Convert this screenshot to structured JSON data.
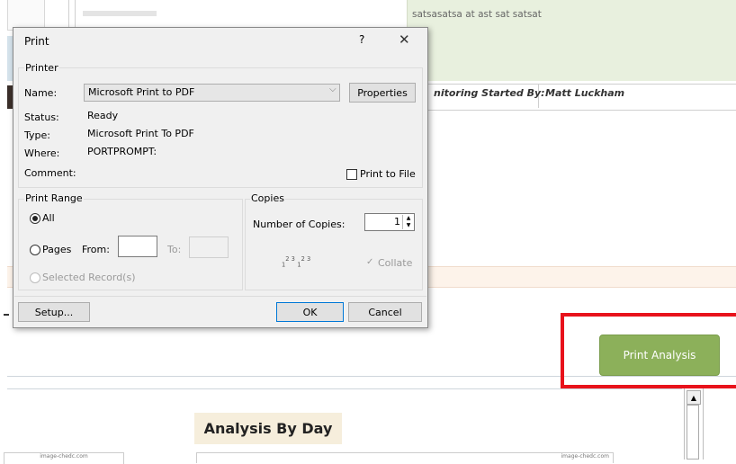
{
  "background": {
    "notes_text": "satsasatsa at ast sat satsat",
    "monitoring_label": "nitoring Started By:",
    "monitoring_value": "Matt Luckham",
    "print_analysis_label": "Print Analysis",
    "analysis_by_day": "Analysis By Day",
    "image_caption_left": "image-chedc.com",
    "image_caption_right": "image-chedc.com",
    "accent_green": "#8cb05a",
    "highlight_red": "#e8121b"
  },
  "dialog": {
    "title": "Print",
    "help": "?",
    "close": "✕",
    "printer_group": "Printer",
    "name_label": "Name:",
    "name_value": "Microsoft Print to PDF",
    "properties_button": "Properties",
    "status_label": "Status:",
    "status_value": "Ready",
    "type_label": "Type:",
    "type_value": "Microsoft Print To PDF",
    "where_label": "Where:",
    "where_value": "PORTPROMPT:",
    "comment_label": "Comment:",
    "print_to_file_label": "Print to File",
    "print_range_group": "Print Range",
    "all_label": "All",
    "pages_label": "Pages",
    "from_label": "From:",
    "to_label": "To:",
    "selected_records_label": "Selected Record(s)",
    "copies_group": "Copies",
    "number_of_copies_label": "Number of Copies:",
    "number_of_copies_value": "1",
    "collate_label": "Collate",
    "setup_button": "Setup...",
    "ok_button": "OK",
    "cancel_button": "Cancel"
  }
}
